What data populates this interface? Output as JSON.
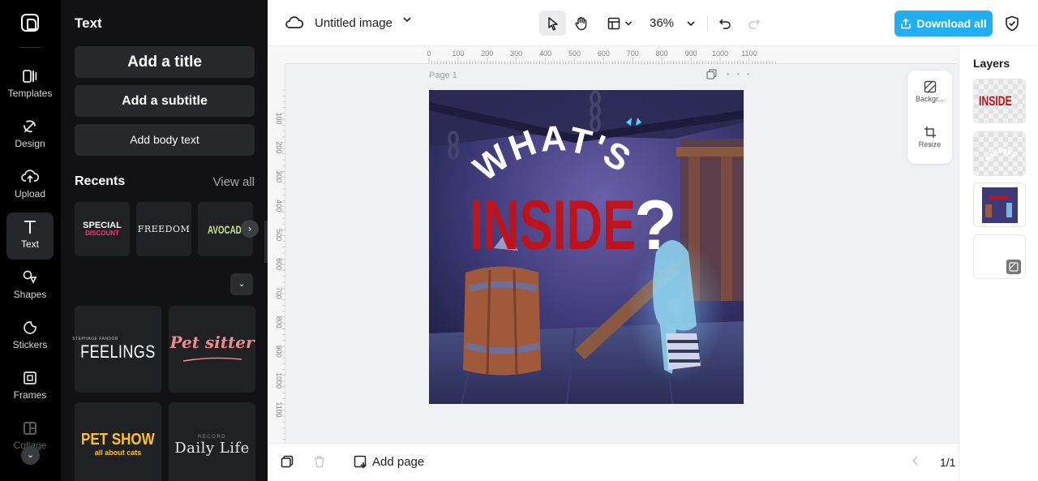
{
  "rail": {
    "items": [
      {
        "label": "Templates",
        "icon": "templates-icon"
      },
      {
        "label": "Design",
        "icon": "design-icon"
      },
      {
        "label": "Upload",
        "icon": "upload-icon"
      },
      {
        "label": "Text",
        "icon": "text-icon",
        "active": true
      },
      {
        "label": "Shapes",
        "icon": "shapes-icon"
      },
      {
        "label": "Stickers",
        "icon": "stickers-icon"
      },
      {
        "label": "Frames",
        "icon": "frames-icon"
      },
      {
        "label": "Collage",
        "icon": "collage-icon"
      }
    ]
  },
  "panel": {
    "title": "Text",
    "add_title": "Add a title",
    "add_subtitle": "Add a subtitle",
    "add_body": "Add body text",
    "recents_label": "Recents",
    "view_all": "View all",
    "recents": [
      "SPECIAL",
      "DISCOUNT",
      "FREEDOM",
      "AVOCADO"
    ],
    "templates": {
      "feelings": "FEELINGS",
      "feelings_small": "STEPHAGE FANDOR",
      "pet_sitter": "Pet sitter",
      "pet_show": "PET SHOW",
      "pet_show_sub": "all about cats",
      "daily_life": "Daily Life",
      "daily_life_small": "RECORD"
    }
  },
  "topbar": {
    "doc_title": "Untitled image",
    "zoom": "36%",
    "download": "Download all"
  },
  "canvas": {
    "page_label": "Page 1",
    "ruler_top": [
      "0",
      "100",
      "200",
      "300",
      "400",
      "500",
      "600",
      "700",
      "800",
      "900",
      "1000",
      "1100"
    ],
    "ruler_left": [
      "100",
      "200",
      "300",
      "400",
      "500",
      "600",
      "700",
      "800",
      "900",
      "1000",
      "1100"
    ],
    "headline_top": "WHAT'S",
    "headline_main": "INSIDE",
    "headline_q": "?"
  },
  "float_tools": {
    "background": "Backgr...",
    "resize": "Resize"
  },
  "bottombar": {
    "add_page": "Add page",
    "page_indicator": "1/1"
  },
  "layers": {
    "title": "Layers",
    "thumb_text": "INSIDE"
  },
  "colors": {
    "accent": "#21aef2",
    "headline_red": "#c0121a"
  }
}
